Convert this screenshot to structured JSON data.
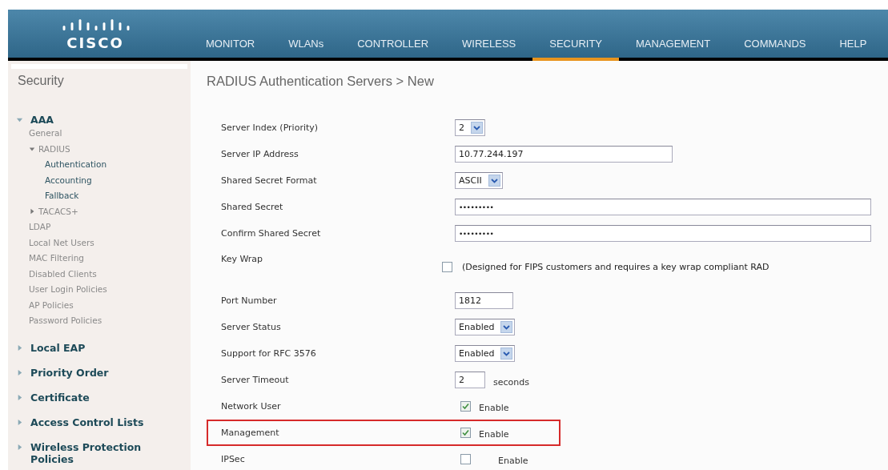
{
  "header": {
    "logo": "CISCO",
    "nav": [
      {
        "label": "MONITOR",
        "selected": false
      },
      {
        "label": "WLANs",
        "selected": false
      },
      {
        "label": "CONTROLLER",
        "selected": false
      },
      {
        "label": "WIRELESS",
        "selected": false
      },
      {
        "label": "SECURITY",
        "selected": true
      },
      {
        "label": "MANAGEMENT",
        "selected": false
      },
      {
        "label": "COMMANDS",
        "selected": false
      },
      {
        "label": "HELP",
        "selected": false
      }
    ]
  },
  "sidebar": {
    "title": "Security",
    "items": [
      {
        "label": "AAA",
        "expanded": true,
        "children": [
          {
            "label": "General"
          },
          {
            "label": "RADIUS",
            "expanded": true,
            "children": [
              {
                "label": "Authentication"
              },
              {
                "label": "Accounting"
              },
              {
                "label": "Fallback"
              }
            ]
          },
          {
            "label": "TACACS+",
            "expanded": false
          },
          {
            "label": "LDAP"
          },
          {
            "label": "Local Net Users"
          },
          {
            "label": "MAC Filtering"
          },
          {
            "label": "Disabled Clients"
          },
          {
            "label": "User Login Policies"
          },
          {
            "label": "AP Policies"
          },
          {
            "label": "Password Policies"
          }
        ]
      },
      {
        "label": "Local EAP",
        "expanded": false
      },
      {
        "label": "Priority Order",
        "expanded": false
      },
      {
        "label": "Certificate",
        "expanded": false
      },
      {
        "label": "Access Control Lists",
        "expanded": false
      },
      {
        "label": "Wireless Protection Policies",
        "expanded": false
      }
    ]
  },
  "page_title": "RADIUS Authentication Servers > New",
  "form": [
    {
      "kind": "select",
      "label": "Server Index (Priority)",
      "value": "2"
    },
    {
      "kind": "text",
      "label": "Server IP Address",
      "value": "10.77.244.197"
    },
    {
      "kind": "select",
      "label": "Shared Secret Format",
      "value": "ASCII"
    },
    {
      "kind": "password",
      "label": "Shared Secret",
      "value": "•••••••••"
    },
    {
      "kind": "password",
      "label": "Confirm Shared Secret",
      "value": "•••••••••"
    },
    {
      "kind": "checkbox-note",
      "label": "Key Wrap",
      "checked": false,
      "note": "(Designed for FIPS customers and requires a key wrap compliant RAD"
    },
    {
      "kind": "short-text",
      "label": "Port Number",
      "value": "1812"
    },
    {
      "kind": "select",
      "label": "Server Status",
      "value": "Enabled"
    },
    {
      "kind": "select",
      "label": "Support for RFC 3576",
      "value": "Enabled"
    },
    {
      "kind": "short-text",
      "label": "Server Timeout",
      "value": "2",
      "suffix": "seconds"
    },
    {
      "kind": "checkbox",
      "label": "Network User",
      "checked": true,
      "option": "Enable",
      "highlighted": false
    },
    {
      "kind": "checkbox",
      "label": "Management",
      "checked": true,
      "option": "Enable",
      "highlighted": true
    },
    {
      "kind": "checkbox",
      "label": "IPSec",
      "checked": false,
      "option": "Enable",
      "highlighted": false
    }
  ]
}
